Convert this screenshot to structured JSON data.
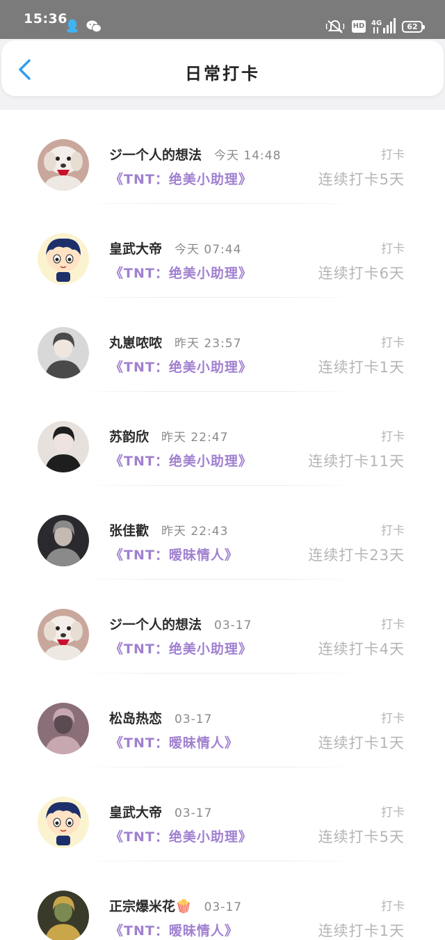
{
  "status_bar": {
    "time": "15:36",
    "icons": [
      "qq-icon",
      "wechat-icon",
      "mute-icon",
      "hd-icon",
      "signal-4g-icon",
      "battery-icon"
    ],
    "hd": "HD",
    "network": "4G",
    "battery": "62"
  },
  "header": {
    "title": "日常打卡",
    "back_icon": "chevron-left-icon"
  },
  "colors": {
    "accent": "#2f9ef0",
    "task_purple": "#a080d0",
    "muted": "#b5b5b5"
  },
  "records": [
    {
      "name": "ジ一个人的想法",
      "time": "今天 14:48",
      "action": "打卡",
      "task": "《TNT：绝美小助理》",
      "streak": "连续打卡5天",
      "avatar": "puppy-avatar"
    },
    {
      "name": "皇武大帝",
      "time": "今天 07:44",
      "action": "打卡",
      "task": "《TNT：绝美小助理》",
      "streak": "连续打卡6天",
      "avatar": "cartoon-boy-avatar"
    },
    {
      "name": "丸崽哝哝",
      "time": "昨天 23:57",
      "action": "打卡",
      "task": "《TNT：绝美小助理》",
      "streak": "连续打卡1天",
      "avatar": "photo-avatar"
    },
    {
      "name": "苏韵欣",
      "time": "昨天 22:47",
      "action": "打卡",
      "task": "《TNT：绝美小助理》",
      "streak": "连续打卡11天",
      "avatar": "photo-avatar"
    },
    {
      "name": "张佳歡",
      "time": "昨天 22:43",
      "action": "打卡",
      "task": "《TNT：暧昧情人》",
      "streak": "连续打卡23天",
      "avatar": "photo-avatar"
    },
    {
      "name": "ジ一个人的想法",
      "time": "03-17",
      "action": "打卡",
      "task": "《TNT：绝美小助理》",
      "streak": "连续打卡4天",
      "avatar": "puppy-avatar"
    },
    {
      "name": "松岛热恋",
      "time": "03-17",
      "action": "打卡",
      "task": "《TNT：暧昧情人》",
      "streak": "连续打卡1天",
      "avatar": "photo-avatar"
    },
    {
      "name": "皇武大帝",
      "time": "03-17",
      "action": "打卡",
      "task": "《TNT：绝美小助理》",
      "streak": "连续打卡5天",
      "avatar": "cartoon-boy-avatar"
    },
    {
      "name": "正宗爆米花🍿",
      "time": "03-17",
      "action": "打卡",
      "task": "《TNT：暧昧情人》",
      "streak": "连续打卡1天",
      "avatar": "photo-avatar"
    }
  ]
}
